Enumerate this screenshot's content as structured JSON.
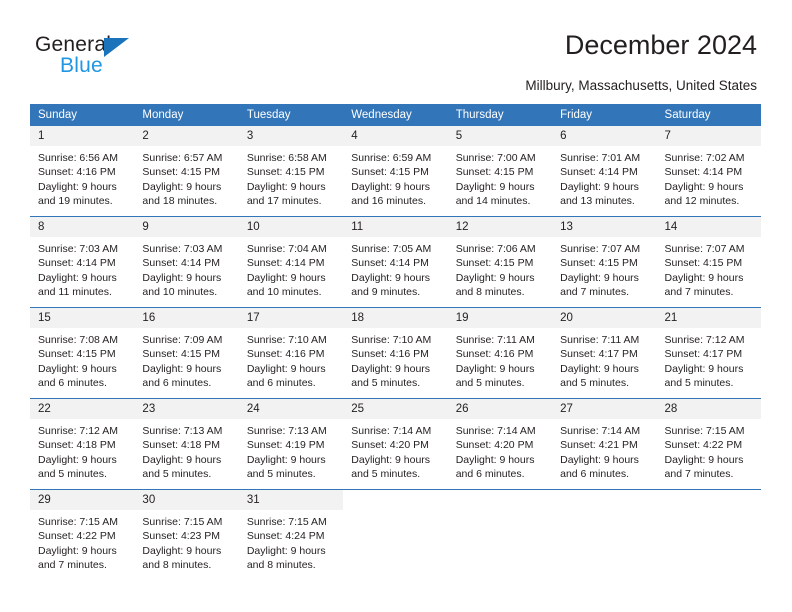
{
  "brand": {
    "name_part1": "General",
    "name_part2": "Blue",
    "accent_color": "#1b74bb",
    "accent_color_2": "#2196e3"
  },
  "header": {
    "title": "December 2024",
    "location": "Millbury, Massachusetts, United States"
  },
  "calendar": {
    "header_color": "#3275b8",
    "daynum_bg": "#f2f2f2",
    "weekday_headers": [
      "Sunday",
      "Monday",
      "Tuesday",
      "Wednesday",
      "Thursday",
      "Friday",
      "Saturday"
    ],
    "weeks": [
      [
        {
          "day": "1",
          "sunrise": "Sunrise: 6:56 AM",
          "sunset": "Sunset: 4:16 PM",
          "daylight1": "Daylight: 9 hours",
          "daylight2": "and 19 minutes."
        },
        {
          "day": "2",
          "sunrise": "Sunrise: 6:57 AM",
          "sunset": "Sunset: 4:15 PM",
          "daylight1": "Daylight: 9 hours",
          "daylight2": "and 18 minutes."
        },
        {
          "day": "3",
          "sunrise": "Sunrise: 6:58 AM",
          "sunset": "Sunset: 4:15 PM",
          "daylight1": "Daylight: 9 hours",
          "daylight2": "and 17 minutes."
        },
        {
          "day": "4",
          "sunrise": "Sunrise: 6:59 AM",
          "sunset": "Sunset: 4:15 PM",
          "daylight1": "Daylight: 9 hours",
          "daylight2": "and 16 minutes."
        },
        {
          "day": "5",
          "sunrise": "Sunrise: 7:00 AM",
          "sunset": "Sunset: 4:15 PM",
          "daylight1": "Daylight: 9 hours",
          "daylight2": "and 14 minutes."
        },
        {
          "day": "6",
          "sunrise": "Sunrise: 7:01 AM",
          "sunset": "Sunset: 4:14 PM",
          "daylight1": "Daylight: 9 hours",
          "daylight2": "and 13 minutes."
        },
        {
          "day": "7",
          "sunrise": "Sunrise: 7:02 AM",
          "sunset": "Sunset: 4:14 PM",
          "daylight1": "Daylight: 9 hours",
          "daylight2": "and 12 minutes."
        }
      ],
      [
        {
          "day": "8",
          "sunrise": "Sunrise: 7:03 AM",
          "sunset": "Sunset: 4:14 PM",
          "daylight1": "Daylight: 9 hours",
          "daylight2": "and 11 minutes."
        },
        {
          "day": "9",
          "sunrise": "Sunrise: 7:03 AM",
          "sunset": "Sunset: 4:14 PM",
          "daylight1": "Daylight: 9 hours",
          "daylight2": "and 10 minutes."
        },
        {
          "day": "10",
          "sunrise": "Sunrise: 7:04 AM",
          "sunset": "Sunset: 4:14 PM",
          "daylight1": "Daylight: 9 hours",
          "daylight2": "and 10 minutes."
        },
        {
          "day": "11",
          "sunrise": "Sunrise: 7:05 AM",
          "sunset": "Sunset: 4:14 PM",
          "daylight1": "Daylight: 9 hours",
          "daylight2": "and 9 minutes."
        },
        {
          "day": "12",
          "sunrise": "Sunrise: 7:06 AM",
          "sunset": "Sunset: 4:15 PM",
          "daylight1": "Daylight: 9 hours",
          "daylight2": "and 8 minutes."
        },
        {
          "day": "13",
          "sunrise": "Sunrise: 7:07 AM",
          "sunset": "Sunset: 4:15 PM",
          "daylight1": "Daylight: 9 hours",
          "daylight2": "and 7 minutes."
        },
        {
          "day": "14",
          "sunrise": "Sunrise: 7:07 AM",
          "sunset": "Sunset: 4:15 PM",
          "daylight1": "Daylight: 9 hours",
          "daylight2": "and 7 minutes."
        }
      ],
      [
        {
          "day": "15",
          "sunrise": "Sunrise: 7:08 AM",
          "sunset": "Sunset: 4:15 PM",
          "daylight1": "Daylight: 9 hours",
          "daylight2": "and 6 minutes."
        },
        {
          "day": "16",
          "sunrise": "Sunrise: 7:09 AM",
          "sunset": "Sunset: 4:15 PM",
          "daylight1": "Daylight: 9 hours",
          "daylight2": "and 6 minutes."
        },
        {
          "day": "17",
          "sunrise": "Sunrise: 7:10 AM",
          "sunset": "Sunset: 4:16 PM",
          "daylight1": "Daylight: 9 hours",
          "daylight2": "and 6 minutes."
        },
        {
          "day": "18",
          "sunrise": "Sunrise: 7:10 AM",
          "sunset": "Sunset: 4:16 PM",
          "daylight1": "Daylight: 9 hours",
          "daylight2": "and 5 minutes."
        },
        {
          "day": "19",
          "sunrise": "Sunrise: 7:11 AM",
          "sunset": "Sunset: 4:16 PM",
          "daylight1": "Daylight: 9 hours",
          "daylight2": "and 5 minutes."
        },
        {
          "day": "20",
          "sunrise": "Sunrise: 7:11 AM",
          "sunset": "Sunset: 4:17 PM",
          "daylight1": "Daylight: 9 hours",
          "daylight2": "and 5 minutes."
        },
        {
          "day": "21",
          "sunrise": "Sunrise: 7:12 AM",
          "sunset": "Sunset: 4:17 PM",
          "daylight1": "Daylight: 9 hours",
          "daylight2": "and 5 minutes."
        }
      ],
      [
        {
          "day": "22",
          "sunrise": "Sunrise: 7:12 AM",
          "sunset": "Sunset: 4:18 PM",
          "daylight1": "Daylight: 9 hours",
          "daylight2": "and 5 minutes."
        },
        {
          "day": "23",
          "sunrise": "Sunrise: 7:13 AM",
          "sunset": "Sunset: 4:18 PM",
          "daylight1": "Daylight: 9 hours",
          "daylight2": "and 5 minutes."
        },
        {
          "day": "24",
          "sunrise": "Sunrise: 7:13 AM",
          "sunset": "Sunset: 4:19 PM",
          "daylight1": "Daylight: 9 hours",
          "daylight2": "and 5 minutes."
        },
        {
          "day": "25",
          "sunrise": "Sunrise: 7:14 AM",
          "sunset": "Sunset: 4:20 PM",
          "daylight1": "Daylight: 9 hours",
          "daylight2": "and 5 minutes."
        },
        {
          "day": "26",
          "sunrise": "Sunrise: 7:14 AM",
          "sunset": "Sunset: 4:20 PM",
          "daylight1": "Daylight: 9 hours",
          "daylight2": "and 6 minutes."
        },
        {
          "day": "27",
          "sunrise": "Sunrise: 7:14 AM",
          "sunset": "Sunset: 4:21 PM",
          "daylight1": "Daylight: 9 hours",
          "daylight2": "and 6 minutes."
        },
        {
          "day": "28",
          "sunrise": "Sunrise: 7:15 AM",
          "sunset": "Sunset: 4:22 PM",
          "daylight1": "Daylight: 9 hours",
          "daylight2": "and 7 minutes."
        }
      ],
      [
        {
          "day": "29",
          "sunrise": "Sunrise: 7:15 AM",
          "sunset": "Sunset: 4:22 PM",
          "daylight1": "Daylight: 9 hours",
          "daylight2": "and 7 minutes."
        },
        {
          "day": "30",
          "sunrise": "Sunrise: 7:15 AM",
          "sunset": "Sunset: 4:23 PM",
          "daylight1": "Daylight: 9 hours",
          "daylight2": "and 8 minutes."
        },
        {
          "day": "31",
          "sunrise": "Sunrise: 7:15 AM",
          "sunset": "Sunset: 4:24 PM",
          "daylight1": "Daylight: 9 hours",
          "daylight2": "and 8 minutes."
        },
        {
          "day": "",
          "sunrise": "",
          "sunset": "",
          "daylight1": "",
          "daylight2": ""
        },
        {
          "day": "",
          "sunrise": "",
          "sunset": "",
          "daylight1": "",
          "daylight2": ""
        },
        {
          "day": "",
          "sunrise": "",
          "sunset": "",
          "daylight1": "",
          "daylight2": ""
        },
        {
          "day": "",
          "sunrise": "",
          "sunset": "",
          "daylight1": "",
          "daylight2": ""
        }
      ]
    ]
  }
}
